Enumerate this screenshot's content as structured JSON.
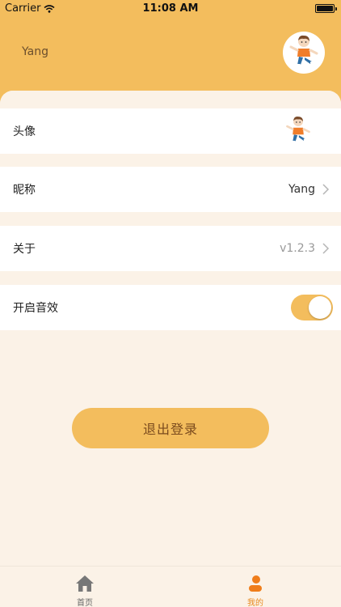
{
  "status": {
    "carrier": "Carrier",
    "time": "11:08 AM"
  },
  "header": {
    "username": "Yang"
  },
  "rows": {
    "avatar": {
      "label": "头像"
    },
    "nickname": {
      "label": "昵称",
      "value": "Yang"
    },
    "about": {
      "label": "关于",
      "value": "v1.2.3"
    },
    "sound": {
      "label": "开启音效",
      "enabled": true
    }
  },
  "logout": {
    "label": "退出登录"
  },
  "tabs": {
    "home": "首页",
    "me": "我的"
  },
  "colors": {
    "accent": "#f3bd5d",
    "active_tab": "#e88a1f",
    "background": "#fbf2e7"
  }
}
